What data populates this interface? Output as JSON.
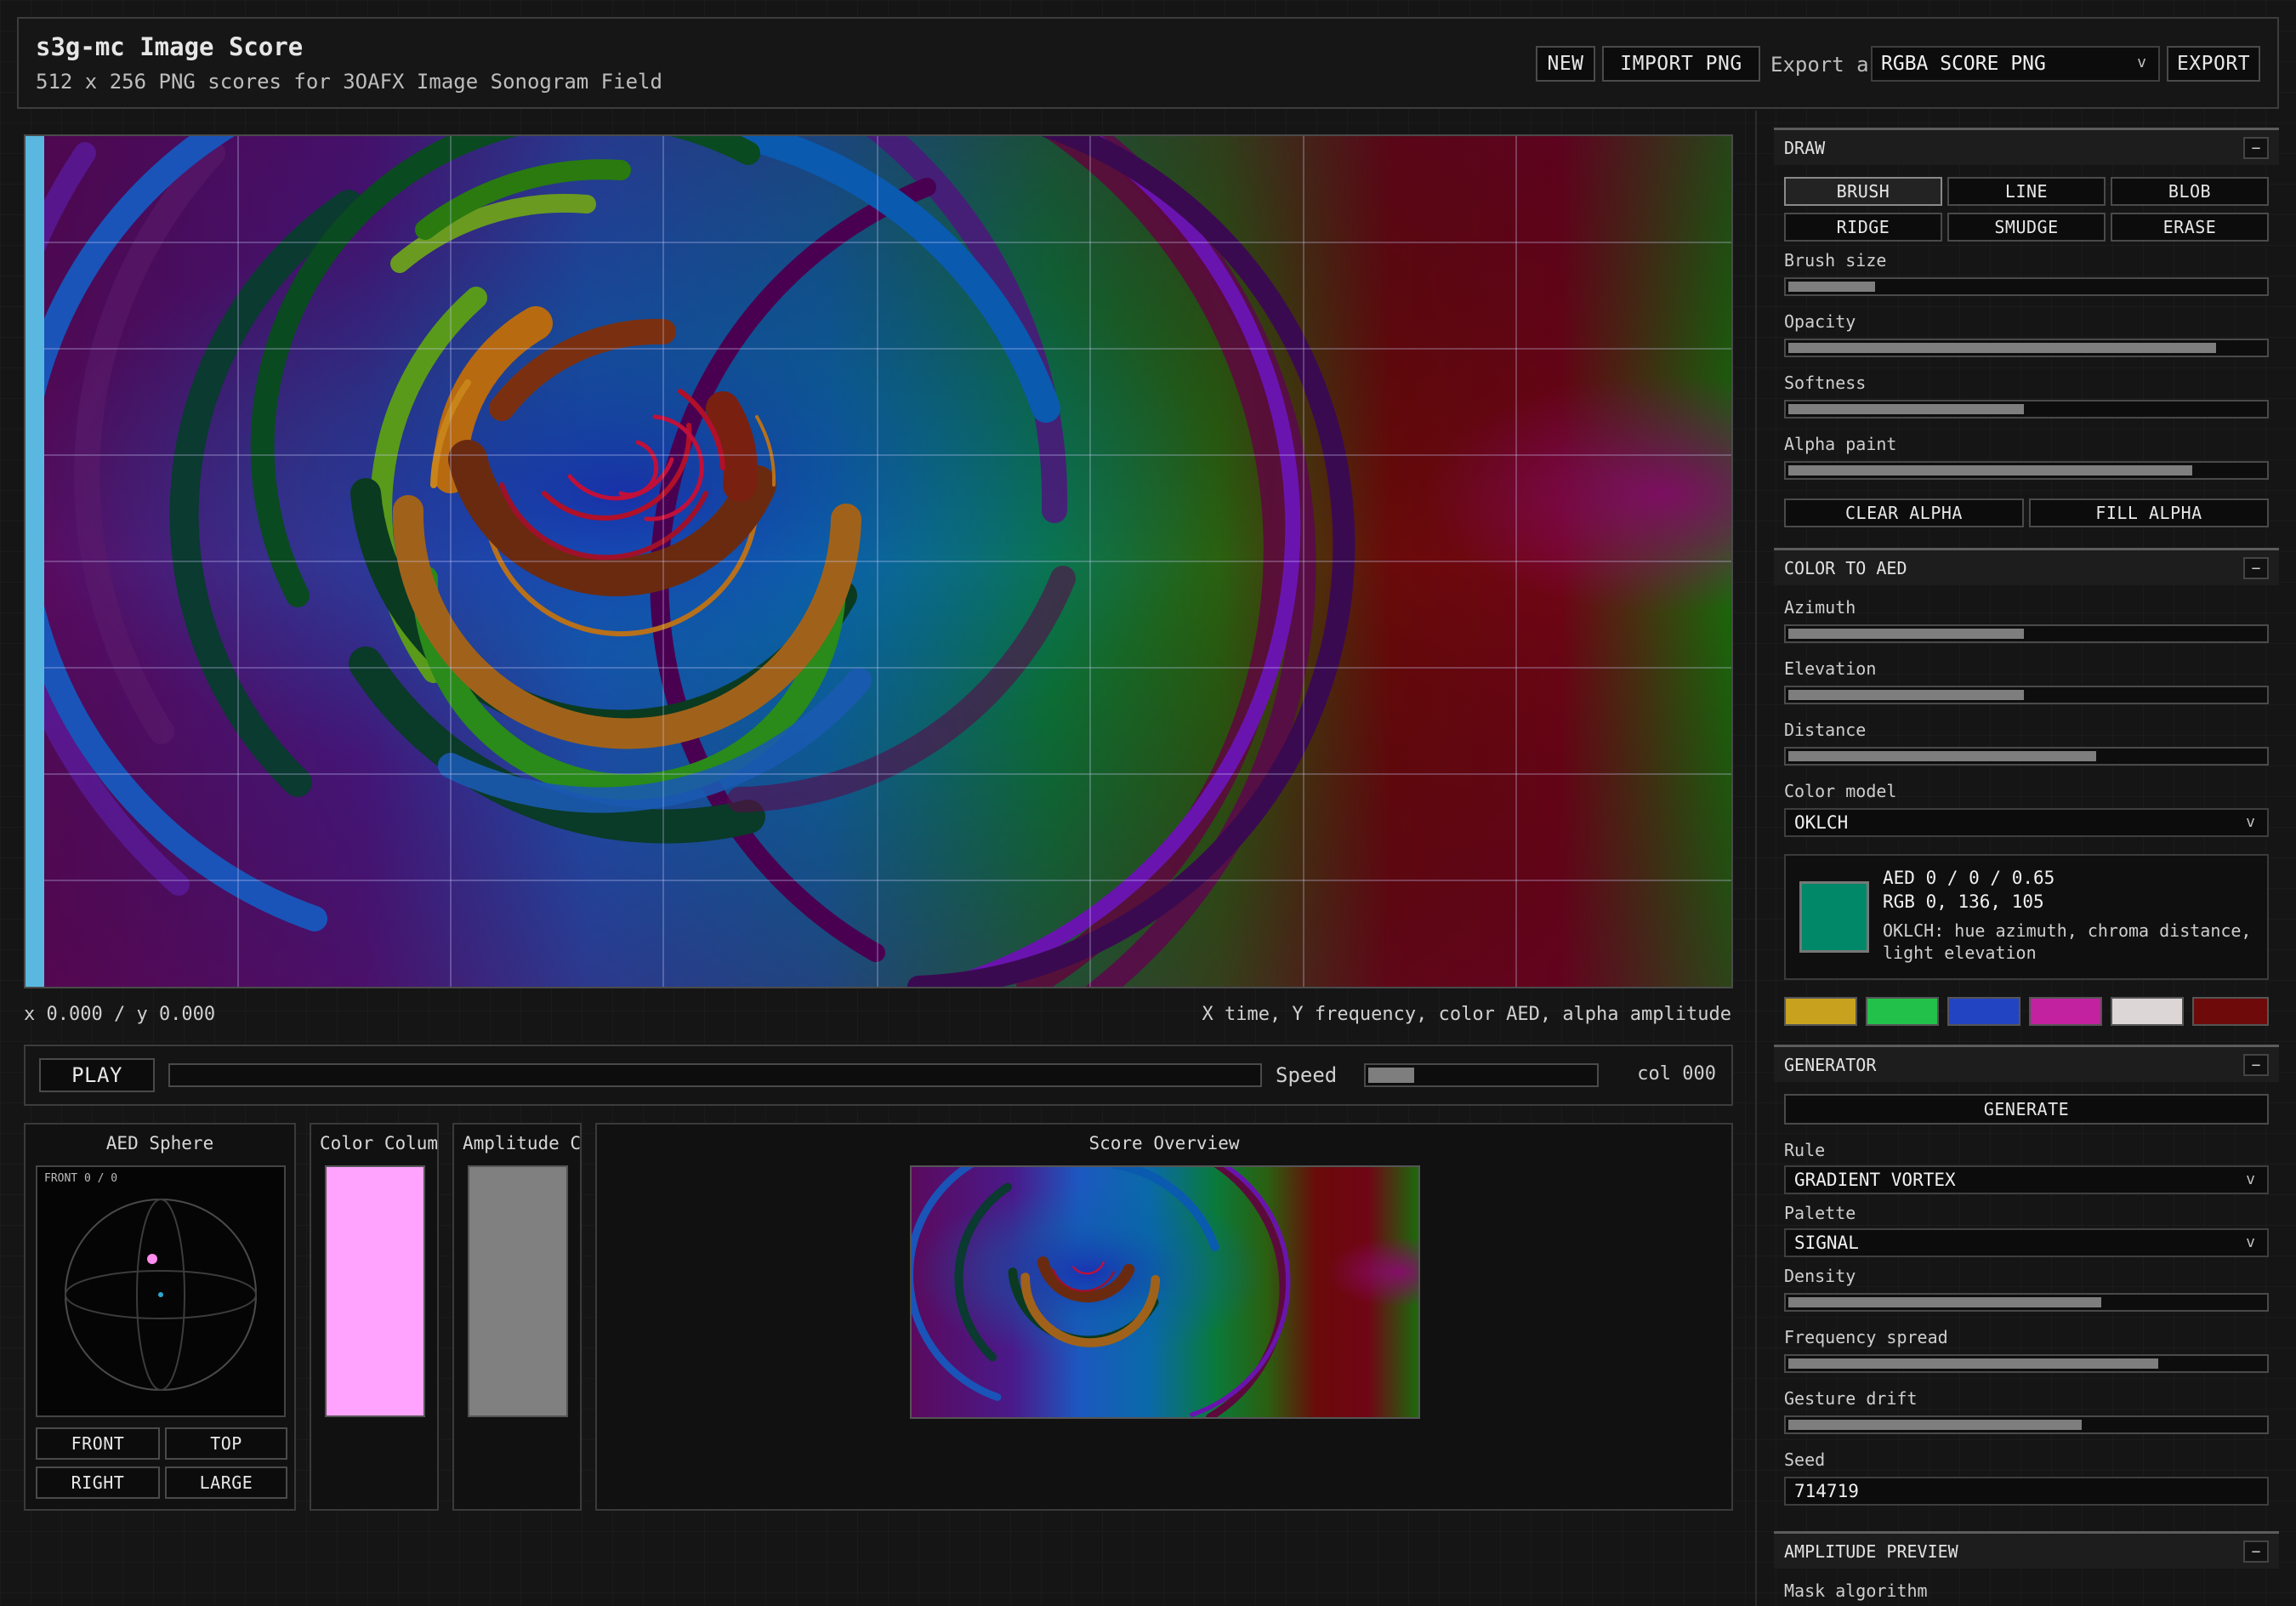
{
  "header": {
    "title": "s3g-mc Image Score",
    "subtitle": "512 x 256 PNG scores for 3OAFX Image Sonogram Field",
    "new_label": "NEW",
    "import_label": "IMPORT PNG",
    "export_as_label": "Export as",
    "export_format": "RGBA SCORE PNG",
    "export_label": "EXPORT"
  },
  "canvas": {
    "coords": "x 0.000 / y 0.000",
    "legend": "X time, Y frequency, color AED, alpha amplitude"
  },
  "transport": {
    "play_label": "PLAY",
    "speed_label": "Speed",
    "speed_value": 0.22,
    "progress_value": 0.0,
    "column_readout": "col 000"
  },
  "aed_sphere": {
    "title": "AED Sphere",
    "view_label": "FRONT 0 / 0",
    "buttons": [
      "FRONT",
      "TOP",
      "RIGHT",
      "LARGE"
    ]
  },
  "color_column": {
    "title": "Color Column",
    "color": "#ffa3ff"
  },
  "amplitude_column": {
    "title": "Amplitude Col",
    "color": "#808080"
  },
  "score_overview": {
    "title": "Score Overview"
  },
  "draw": {
    "title": "DRAW",
    "collapse": "−",
    "tools": [
      "BRUSH",
      "LINE",
      "BLOB",
      "RIDGE",
      "SMUDGE",
      "ERASE"
    ],
    "active_tool": "BRUSH",
    "sliders": [
      {
        "label": "Brush size",
        "value": 0.19
      },
      {
        "label": "Opacity",
        "value": 0.9
      },
      {
        "label": "Softness",
        "value": 0.5
      },
      {
        "label": "Alpha paint",
        "value": 0.85
      }
    ],
    "clear_alpha_label": "CLEAR ALPHA",
    "fill_alpha_label": "FILL ALPHA"
  },
  "color_to_aed": {
    "title": "COLOR TO AED",
    "collapse": "−",
    "sliders": [
      {
        "label": "Azimuth",
        "value": 0.5
      },
      {
        "label": "Elevation",
        "value": 0.5
      },
      {
        "label": "Distance",
        "value": 0.65
      }
    ],
    "color_model_label": "Color model",
    "color_model": "OKLCH",
    "aed_readout": "AED 0 / 0 / 0.65",
    "rgb_readout": "RGB 0, 136, 105",
    "note_line1": "OKLCH: hue azimuth, chroma distance,",
    "note_line2": "light elevation",
    "preview_color": "#008869",
    "palette": [
      "#c8a21e",
      "#22c24a",
      "#2244c2",
      "#c222a0",
      "#ddd6d6",
      "#6e0a0a"
    ]
  },
  "generator": {
    "title": "GENERATOR",
    "collapse": "−",
    "generate_label": "GENERATE",
    "rule_label": "Rule",
    "rule": "GRADIENT VORTEX",
    "palette_label": "Palette",
    "palette": "SIGNAL",
    "sliders": [
      {
        "label": "Density",
        "value": 0.66
      },
      {
        "label": "Frequency spread",
        "value": 0.78
      },
      {
        "label": "Gesture drift",
        "value": 0.62
      }
    ],
    "seed_label": "Seed",
    "seed": "714719"
  },
  "amplitude_preview": {
    "title": "AMPLITUDE PREVIEW",
    "collapse": "−",
    "mask_label": "Mask algorithm"
  }
}
